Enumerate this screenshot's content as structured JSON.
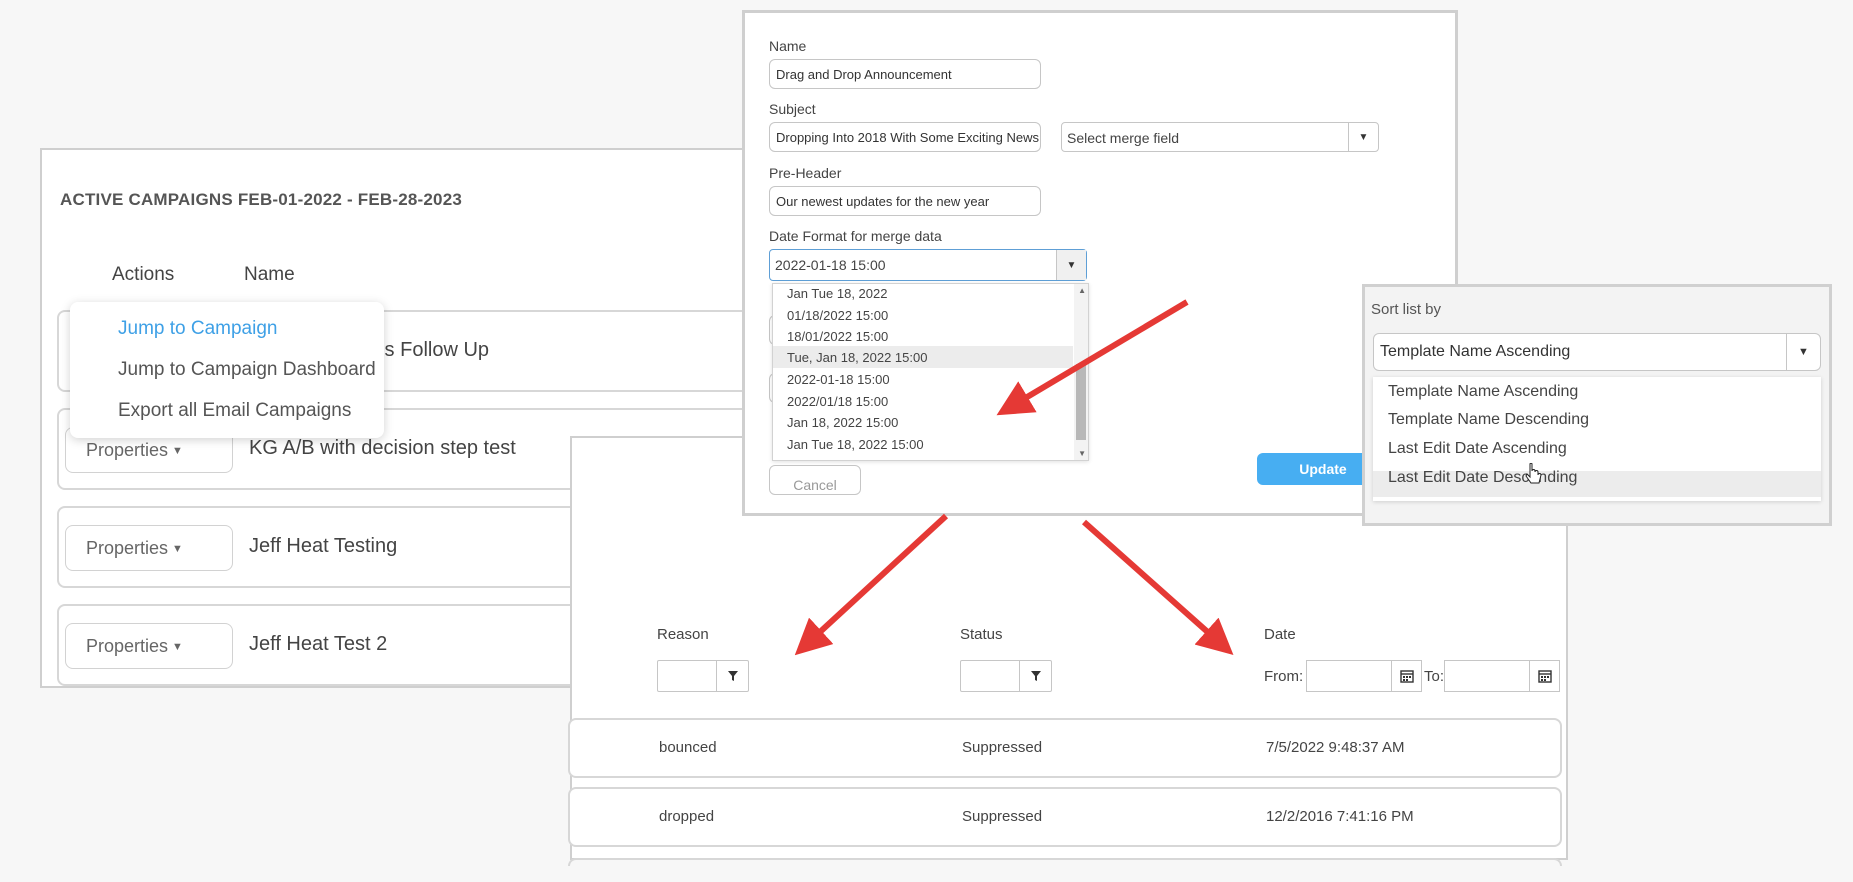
{
  "campaigns": {
    "title": "ACTIVE CAMPAIGNS FEB-01-2022 - FEB-28-2023",
    "col_actions": "Actions",
    "col_name": "Name",
    "properties_label": "Properties",
    "rows": [
      {
        "name": "ct Us Follow Up"
      },
      {
        "name": "KG A/B with decision step test"
      },
      {
        "name": "Jeff Heat Testing"
      },
      {
        "name": "Jeff Heat Test 2"
      }
    ],
    "menu": [
      {
        "label": "Jump to Campaign"
      },
      {
        "label": "Jump to Campaign Dashboard"
      },
      {
        "label": "Export all Email Campaigns"
      }
    ]
  },
  "form": {
    "name_label": "Name",
    "name_value": "Drag and Drop Announcement",
    "subject_label": "Subject",
    "subject_value": "Dropping Into 2018 With Some Exciting News",
    "merge_placeholder": "Select merge field",
    "preheader_label": "Pre-Header",
    "preheader_value": "Our newest updates for the new year",
    "date_format_label": "Date Format for merge data",
    "date_format_value": "2022-01-18 15:00",
    "date_options": [
      "Jan Tue 18, 2022",
      "01/18/2022 15:00",
      "18/01/2022 15:00",
      "Tue, Jan 18, 2022 15:00",
      "2022-01-18 15:00",
      "2022/01/18 15:00",
      "Jan 18, 2022 15:00",
      "Jan Tue 18, 2022 15:00"
    ],
    "cancel_label": "Cancel",
    "update_label": "Update"
  },
  "sort": {
    "label": "Sort list by",
    "selected": "Template Name Ascending",
    "options": [
      "Template Name Ascending",
      "Template Name Descending",
      "Last Edit Date Ascending",
      "Last Edit Date Descending"
    ]
  },
  "suppressions": {
    "reason_label": "Reason",
    "status_label": "Status",
    "date_label": "Date",
    "from_label": "From:",
    "to_label": "To:",
    "rows": [
      {
        "reason": "bounced",
        "status": "Suppressed",
        "date": "7/5/2022 9:48:37 AM"
      },
      {
        "reason": "dropped",
        "status": "Suppressed",
        "date": "12/2/2016 7:41:16 PM"
      }
    ]
  },
  "colors": {
    "accent_blue": "#47aef2",
    "menu_active": "#3ea0e6",
    "arrow_red": "#e53935"
  }
}
